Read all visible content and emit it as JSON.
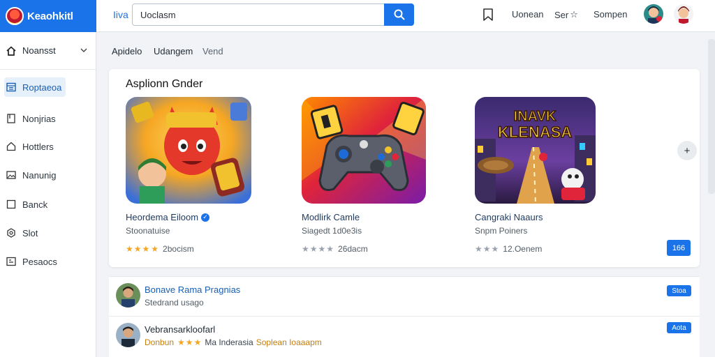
{
  "brand": {
    "name": "Keaohkitl"
  },
  "search": {
    "scope_label": "Iiva",
    "value": "Uoclasm"
  },
  "header": {
    "links": [
      "Uonean",
      "Ser",
      "Sompen"
    ]
  },
  "sidebar": {
    "header_label": "Noansst",
    "items": [
      {
        "label": "Roptaeoa",
        "icon": "grid-icon",
        "active": true
      },
      {
        "label": "Nonjrias",
        "icon": "bookmark-icon"
      },
      {
        "label": "Hottlers",
        "icon": "home-icon"
      },
      {
        "label": "Nanunig",
        "icon": "image-icon"
      },
      {
        "label": "Banck",
        "icon": "square-icon"
      },
      {
        "label": "Slot",
        "icon": "settings-icon"
      },
      {
        "label": "Pesaocs",
        "icon": "star-box-icon"
      }
    ]
  },
  "tabs": [
    "Apidelo",
    "Udangem",
    "Vend"
  ],
  "featured": {
    "title": "Asplionn Gnder",
    "apps": [
      {
        "name": "Heordema Eiloom",
        "sub": "Stoonatuise",
        "stars_filled": 4,
        "stars_empty": 0,
        "count": "2bocism",
        "verified": true
      },
      {
        "name": "Modlirk Camle",
        "sub": "Siagedt 1d0e3is",
        "stars_filled": 0,
        "stars_empty": 4,
        "count": "26dacm"
      },
      {
        "name": "Cangraki Naaurs",
        "sub": "Snpm Poiners",
        "stars_filled": 0,
        "stars_empty": 3,
        "count": "12.Oenem"
      }
    ],
    "art_titles": {
      "third_line1": "INAVK",
      "third_line2": "KLENASA"
    },
    "install_label": "166"
  },
  "list": [
    {
      "title": "Bonave Rama Pragnias",
      "sub": "Stedrand usago",
      "button": "Stoa"
    },
    {
      "title": "Vebransarkloofarl",
      "meta_tag": "Donbun",
      "meta_stars": "★★★",
      "meta_mid": "Ma Inderasia",
      "meta_loc": "Soplean Ioaaapm",
      "button": "Aota"
    }
  ],
  "colors": {
    "accent": "#1a73e8",
    "star": "#f4a622"
  }
}
